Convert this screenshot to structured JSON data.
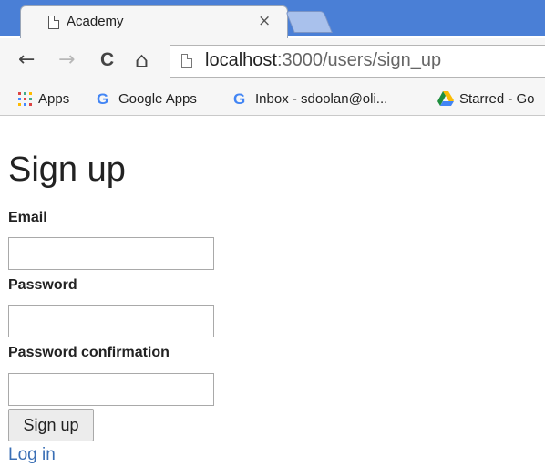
{
  "browser": {
    "tab": {
      "title": "Academy",
      "close_glyph": "×"
    },
    "nav": {
      "back": "←",
      "forward": "→",
      "reload": "C",
      "home": "⌂"
    },
    "address": {
      "host": "localhost",
      "rest": ":3000/users/sign_up"
    },
    "bookmarks": [
      {
        "label": "Apps",
        "icon": "apps-grid-icon"
      },
      {
        "label": "Google Apps",
        "icon": "google-icon"
      },
      {
        "label": "Inbox - sdoolan@oli...",
        "icon": "google-icon"
      },
      {
        "label": "Starred - Go",
        "icon": "google-drive-icon"
      }
    ],
    "google_glyph": "G"
  },
  "page": {
    "heading": "Sign up",
    "email_label": "Email",
    "password_label": "Password",
    "password_confirmation_label": "Password confirmation",
    "submit_label": "Sign up",
    "login_link": "Log in"
  }
}
